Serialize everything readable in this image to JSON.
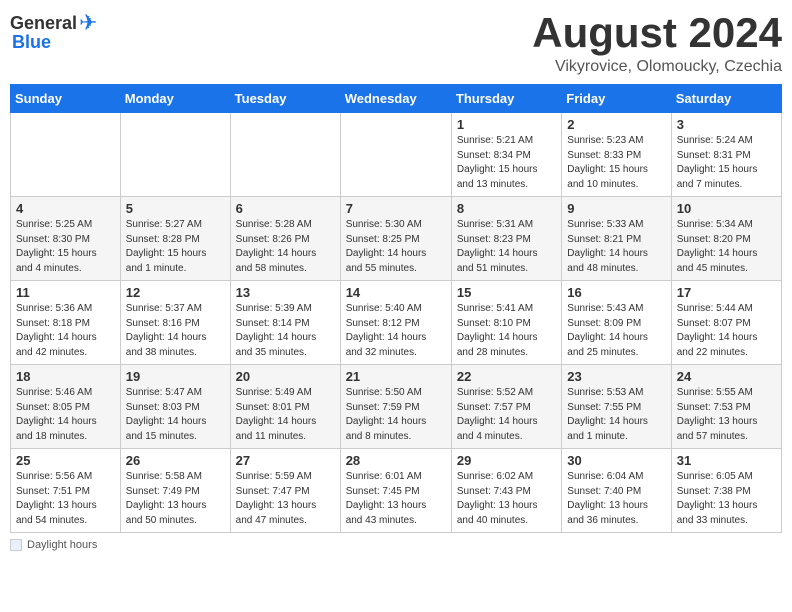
{
  "header": {
    "logo_general": "General",
    "logo_blue": "Blue",
    "month_year": "August 2024",
    "location": "Vikyrovice, Olomoucky, Czechia"
  },
  "calendar": {
    "days_of_week": [
      "Sunday",
      "Monday",
      "Tuesday",
      "Wednesday",
      "Thursday",
      "Friday",
      "Saturday"
    ],
    "weeks": [
      [
        {
          "day": "",
          "info": ""
        },
        {
          "day": "",
          "info": ""
        },
        {
          "day": "",
          "info": ""
        },
        {
          "day": "",
          "info": ""
        },
        {
          "day": "1",
          "info": "Sunrise: 5:21 AM\nSunset: 8:34 PM\nDaylight: 15 hours\nand 13 minutes."
        },
        {
          "day": "2",
          "info": "Sunrise: 5:23 AM\nSunset: 8:33 PM\nDaylight: 15 hours\nand 10 minutes."
        },
        {
          "day": "3",
          "info": "Sunrise: 5:24 AM\nSunset: 8:31 PM\nDaylight: 15 hours\nand 7 minutes."
        }
      ],
      [
        {
          "day": "4",
          "info": "Sunrise: 5:25 AM\nSunset: 8:30 PM\nDaylight: 15 hours\nand 4 minutes."
        },
        {
          "day": "5",
          "info": "Sunrise: 5:27 AM\nSunset: 8:28 PM\nDaylight: 15 hours\nand 1 minute."
        },
        {
          "day": "6",
          "info": "Sunrise: 5:28 AM\nSunset: 8:26 PM\nDaylight: 14 hours\nand 58 minutes."
        },
        {
          "day": "7",
          "info": "Sunrise: 5:30 AM\nSunset: 8:25 PM\nDaylight: 14 hours\nand 55 minutes."
        },
        {
          "day": "8",
          "info": "Sunrise: 5:31 AM\nSunset: 8:23 PM\nDaylight: 14 hours\nand 51 minutes."
        },
        {
          "day": "9",
          "info": "Sunrise: 5:33 AM\nSunset: 8:21 PM\nDaylight: 14 hours\nand 48 minutes."
        },
        {
          "day": "10",
          "info": "Sunrise: 5:34 AM\nSunset: 8:20 PM\nDaylight: 14 hours\nand 45 minutes."
        }
      ],
      [
        {
          "day": "11",
          "info": "Sunrise: 5:36 AM\nSunset: 8:18 PM\nDaylight: 14 hours\nand 42 minutes."
        },
        {
          "day": "12",
          "info": "Sunrise: 5:37 AM\nSunset: 8:16 PM\nDaylight: 14 hours\nand 38 minutes."
        },
        {
          "day": "13",
          "info": "Sunrise: 5:39 AM\nSunset: 8:14 PM\nDaylight: 14 hours\nand 35 minutes."
        },
        {
          "day": "14",
          "info": "Sunrise: 5:40 AM\nSunset: 8:12 PM\nDaylight: 14 hours\nand 32 minutes."
        },
        {
          "day": "15",
          "info": "Sunrise: 5:41 AM\nSunset: 8:10 PM\nDaylight: 14 hours\nand 28 minutes."
        },
        {
          "day": "16",
          "info": "Sunrise: 5:43 AM\nSunset: 8:09 PM\nDaylight: 14 hours\nand 25 minutes."
        },
        {
          "day": "17",
          "info": "Sunrise: 5:44 AM\nSunset: 8:07 PM\nDaylight: 14 hours\nand 22 minutes."
        }
      ],
      [
        {
          "day": "18",
          "info": "Sunrise: 5:46 AM\nSunset: 8:05 PM\nDaylight: 14 hours\nand 18 minutes."
        },
        {
          "day": "19",
          "info": "Sunrise: 5:47 AM\nSunset: 8:03 PM\nDaylight: 14 hours\nand 15 minutes."
        },
        {
          "day": "20",
          "info": "Sunrise: 5:49 AM\nSunset: 8:01 PM\nDaylight: 14 hours\nand 11 minutes."
        },
        {
          "day": "21",
          "info": "Sunrise: 5:50 AM\nSunset: 7:59 PM\nDaylight: 14 hours\nand 8 minutes."
        },
        {
          "day": "22",
          "info": "Sunrise: 5:52 AM\nSunset: 7:57 PM\nDaylight: 14 hours\nand 4 minutes."
        },
        {
          "day": "23",
          "info": "Sunrise: 5:53 AM\nSunset: 7:55 PM\nDaylight: 14 hours\nand 1 minute."
        },
        {
          "day": "24",
          "info": "Sunrise: 5:55 AM\nSunset: 7:53 PM\nDaylight: 13 hours\nand 57 minutes."
        }
      ],
      [
        {
          "day": "25",
          "info": "Sunrise: 5:56 AM\nSunset: 7:51 PM\nDaylight: 13 hours\nand 54 minutes."
        },
        {
          "day": "26",
          "info": "Sunrise: 5:58 AM\nSunset: 7:49 PM\nDaylight: 13 hours\nand 50 minutes."
        },
        {
          "day": "27",
          "info": "Sunrise: 5:59 AM\nSunset: 7:47 PM\nDaylight: 13 hours\nand 47 minutes."
        },
        {
          "day": "28",
          "info": "Sunrise: 6:01 AM\nSunset: 7:45 PM\nDaylight: 13 hours\nand 43 minutes."
        },
        {
          "day": "29",
          "info": "Sunrise: 6:02 AM\nSunset: 7:43 PM\nDaylight: 13 hours\nand 40 minutes."
        },
        {
          "day": "30",
          "info": "Sunrise: 6:04 AM\nSunset: 7:40 PM\nDaylight: 13 hours\nand 36 minutes."
        },
        {
          "day": "31",
          "info": "Sunrise: 6:05 AM\nSunset: 7:38 PM\nDaylight: 13 hours\nand 33 minutes."
        }
      ]
    ]
  },
  "footer": {
    "daylight_label": "Daylight hours"
  }
}
